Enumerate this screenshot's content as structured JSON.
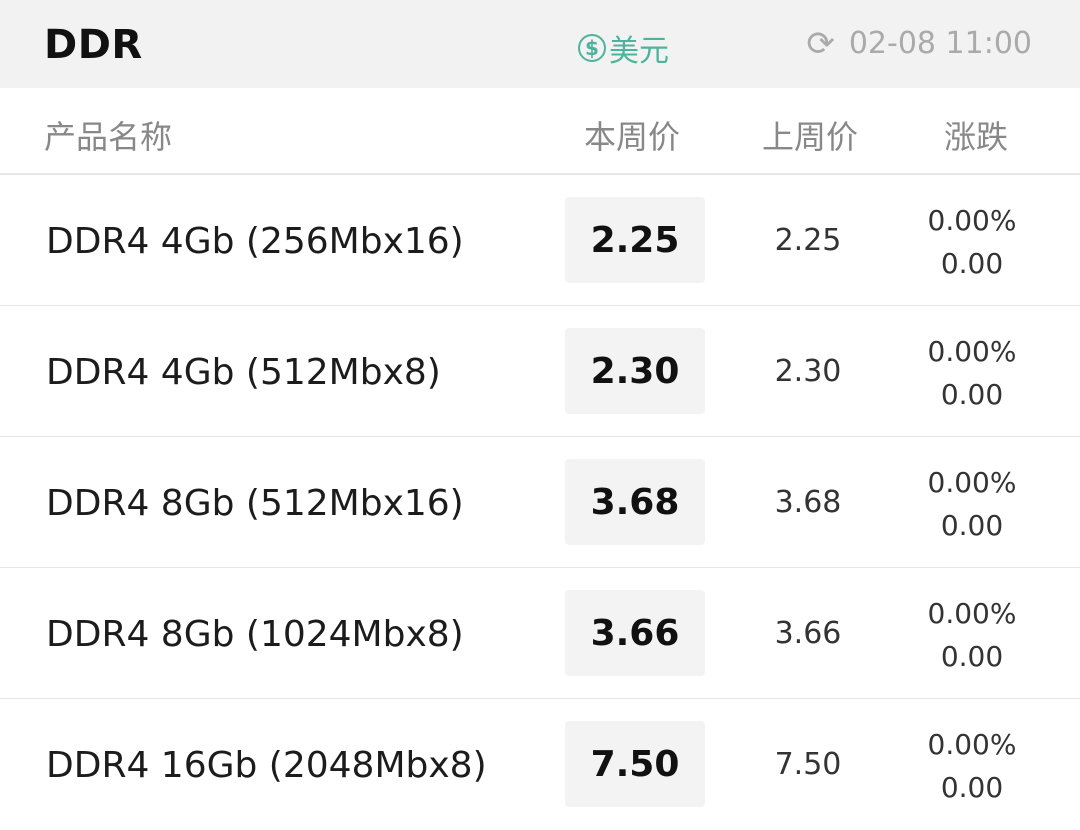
{
  "header": {
    "title": "DDR",
    "currency_symbol": "$",
    "currency_label": "美元",
    "refresh_icon": "refresh-icon",
    "timestamp": "02-08 11:00"
  },
  "columns": {
    "name": "产品名称",
    "this_week": "本周价",
    "last_week": "上周价",
    "change": "涨跌"
  },
  "rows": [
    {
      "name": "DDR4 4Gb (256Mbx16)",
      "this_week": "2.25",
      "last_week": "2.25",
      "change_pct": "0.00%",
      "change_abs": "0.00"
    },
    {
      "name": "DDR4 4Gb (512Mbx8)",
      "this_week": "2.30",
      "last_week": "2.30",
      "change_pct": "0.00%",
      "change_abs": "0.00"
    },
    {
      "name": "DDR4 8Gb (512Mbx16)",
      "this_week": "3.68",
      "last_week": "3.68",
      "change_pct": "0.00%",
      "change_abs": "0.00"
    },
    {
      "name": "DDR4 8Gb (1024Mbx8)",
      "this_week": "3.66",
      "last_week": "3.66",
      "change_pct": "0.00%",
      "change_abs": "0.00"
    },
    {
      "name": "DDR4 16Gb (2048Mbx8)",
      "this_week": "7.50",
      "last_week": "7.50",
      "change_pct": "0.00%",
      "change_abs": "0.00"
    }
  ],
  "colors": {
    "accent": "#4db39c",
    "header_bg": "#f2f2f2",
    "price_box_bg": "#f3f3f3"
  }
}
